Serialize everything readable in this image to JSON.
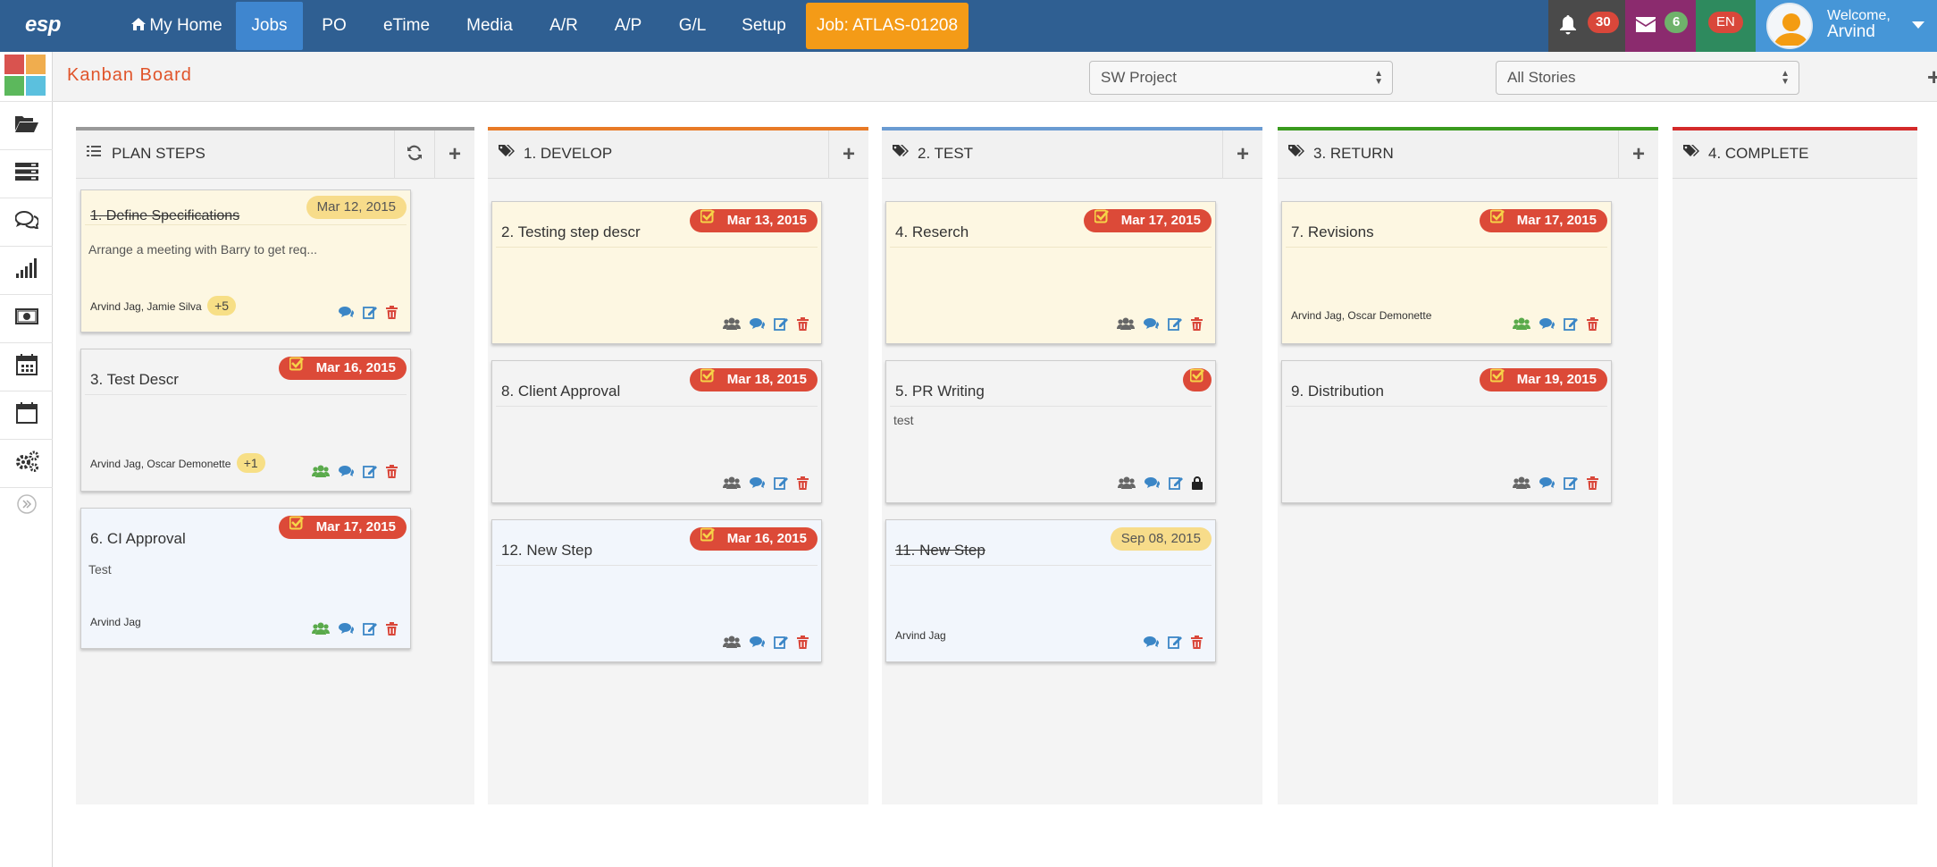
{
  "app": {
    "logo": "esp"
  },
  "nav": {
    "items": [
      {
        "label": "My Home",
        "active": false
      },
      {
        "label": "Jobs",
        "active": true
      },
      {
        "label": "PO",
        "active": false
      },
      {
        "label": "eTime",
        "active": false
      },
      {
        "label": "Media",
        "active": false
      },
      {
        "label": "A/R",
        "active": false
      },
      {
        "label": "A/P",
        "active": false
      },
      {
        "label": "G/L",
        "active": false
      },
      {
        "label": "Setup",
        "active": false
      }
    ],
    "job_label": "Job: ATLAS-01208",
    "notifications_count": "30",
    "messages_count": "6",
    "language": "EN",
    "welcome": "Welcome,",
    "user_name": "Arvind"
  },
  "toolbar": {
    "title": "Kanban Board",
    "project_select": "SW Project",
    "stories_select": "All Stories"
  },
  "columns": [
    {
      "title": "PLAN STEPS",
      "color": "#999999"
    },
    {
      "title": "1. DEVELOP",
      "color": "#e87a26"
    },
    {
      "title": "2. TEST",
      "color": "#6a9bd2"
    },
    {
      "title": "3. RETURN",
      "color": "#3a9a1e"
    },
    {
      "title": "4. COMPLETE",
      "color": "#d42a2a"
    }
  ],
  "cards": {
    "c1": {
      "title": "1. Define Specifications",
      "date": "Mar 12, 2015",
      "desc": "Arrange a meeting with Barry to get req...",
      "users": "Arvind Jag, Jamie Silva",
      "more": "+5"
    },
    "c3": {
      "title": "3. Test Descr",
      "date": "Mar 16, 2015",
      "users": "Arvind Jag, Oscar Demonette",
      "more": "+1"
    },
    "c6": {
      "title": "6. CI Approval",
      "date": "Mar 17, 2015",
      "desc": "Test",
      "users": "Arvind Jag"
    },
    "c2": {
      "title": "2. Testing step descr",
      "date": "Mar 13, 2015"
    },
    "c8": {
      "title": "8. Client Approval",
      "date": "Mar 18, 2015"
    },
    "c12": {
      "title": "12. New Step",
      "date": "Mar 16, 2015"
    },
    "c4": {
      "title": "4. Reserch",
      "date": "Mar 17, 2015"
    },
    "c5": {
      "title": "5. PR Writing",
      "desc": "test"
    },
    "c11": {
      "title": "11. New Step",
      "date": "Sep 08, 2015",
      "users": "Arvind Jag"
    },
    "c7": {
      "title": "7. Revisions",
      "date": "Mar 17, 2015",
      "users": "Arvind Jag, Oscar Demonette"
    },
    "c9": {
      "title": "9. Distribution",
      "date": "Mar 19, 2015"
    }
  },
  "colors": {
    "nav_bg": "#2f5f92",
    "active_tab": "#3f86cf",
    "job_button": "#f49b17",
    "date_red": "#dc4a38"
  }
}
